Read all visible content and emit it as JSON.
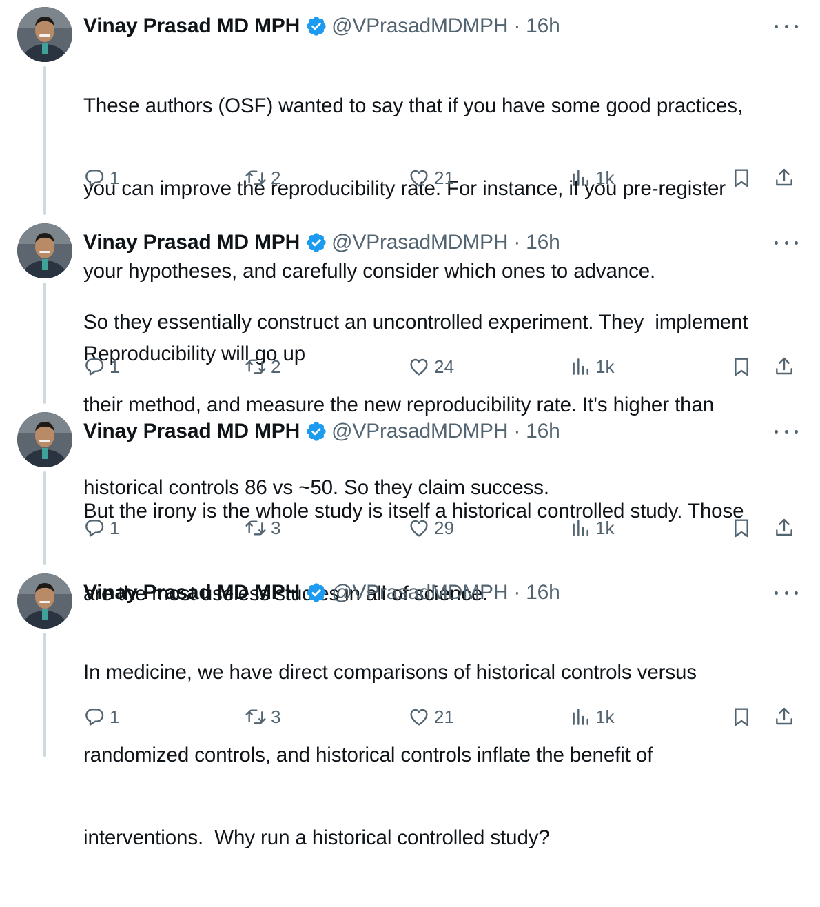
{
  "colors": {
    "text": "#0f1419",
    "secondary": "#536471",
    "verified": "#1d9bf0",
    "thread_line": "#cfd9de"
  },
  "icons": {
    "reply": "speech-bubble",
    "repost": "two-arrows-loop",
    "like": "heart",
    "views": "bar-chart",
    "bookmark": "bookmark",
    "share": "arrow-up-from-tray",
    "more": "three-dots",
    "verified": "blue-check-badge"
  },
  "tweets": [
    {
      "name": "Vinay Prasad MD MPH",
      "handle": "@VPrasadMDMPH",
      "separator": "·",
      "time": "16h",
      "lines": [
        "These authors (OSF) wanted to say that if you have some good practices,",
        "you can improve the reproducibility rate. For instance, if you pre-register",
        "your hypotheses, and carefully consider which ones to advance.",
        "Reproducibility will go up"
      ],
      "replies": "1",
      "reposts": "2",
      "likes": "21",
      "views": "1k"
    },
    {
      "name": "Vinay Prasad MD MPH",
      "handle": "@VPrasadMDMPH",
      "separator": "·",
      "time": "16h",
      "lines": [
        "So they essentially construct an uncontrolled experiment. They  implement",
        "their method, and measure the new reproducibility rate. It's higher than",
        "historical controls 86 vs ~50. So they claim success."
      ],
      "replies": "1",
      "reposts": "2",
      "likes": "24",
      "views": "1k"
    },
    {
      "name": "Vinay Prasad MD MPH",
      "handle": "@VPrasadMDMPH",
      "separator": "·",
      "time": "16h",
      "lines": [
        "But the irony is the whole study is itself a historical controlled study. Those",
        "are the most useless studies in all of science."
      ],
      "replies": "1",
      "reposts": "3",
      "likes": "29",
      "views": "1k"
    },
    {
      "name": "Vinay Prasad MD MPH",
      "handle": "@VPrasadMDMPH",
      "separator": "·",
      "time": "16h",
      "lines": [
        "In medicine, we have direct comparisons of historical controls versus",
        "randomized controls, and historical controls inflate the benefit of",
        "interventions.  Why run a historical controlled study?"
      ],
      "replies": "1",
      "reposts": "3",
      "likes": "21",
      "views": "1k"
    }
  ]
}
